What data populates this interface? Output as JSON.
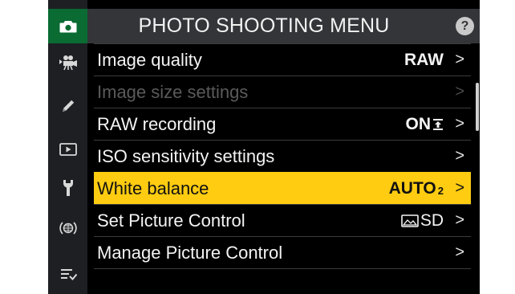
{
  "header": {
    "title": "PHOTO SHOOTING MENU",
    "help": "?"
  },
  "tabs": [
    {
      "icon": "camera-icon",
      "active": true
    },
    {
      "icon": "movie-camera-icon",
      "active": false
    },
    {
      "icon": "pencil-icon",
      "active": false
    },
    {
      "icon": "playback-icon",
      "active": false
    },
    {
      "icon": "wrench-icon",
      "active": false
    },
    {
      "icon": "network-icon",
      "active": false
    },
    {
      "icon": "my-menu-icon",
      "active": false
    }
  ],
  "menu": [
    {
      "label": "Image quality",
      "value": "RAW",
      "state": "normal"
    },
    {
      "label": "Image size settings",
      "value": "",
      "state": "disabled"
    },
    {
      "label": "RAW recording",
      "value": "ON",
      "value_icon": "raw-recording-icon",
      "state": "normal"
    },
    {
      "label": "ISO sensitivity settings",
      "value": "",
      "state": "normal"
    },
    {
      "label": "White balance",
      "value": "AUTO",
      "value_sub": "2",
      "state": "selected"
    },
    {
      "label": "Set Picture Control",
      "value": "SD",
      "value_icon": "picture-control-icon",
      "state": "normal"
    },
    {
      "label": "Manage Picture Control",
      "value": "",
      "state": "normal"
    }
  ],
  "chevron": ">",
  "colors": {
    "selected": "#ffcc11",
    "active_tab": "#0a6b33"
  }
}
